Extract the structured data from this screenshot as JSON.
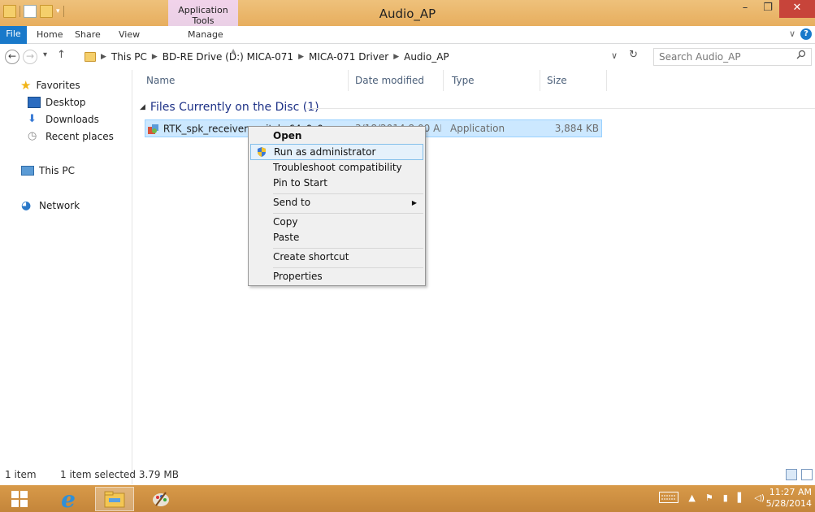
{
  "window": {
    "title": "Audio_AP",
    "contextual_tab_title": "Application Tools",
    "minimize": "–",
    "maximize": "❐",
    "close": "✕"
  },
  "ribbon": {
    "tabs": [
      "File",
      "Home",
      "Share",
      "View",
      "Manage"
    ],
    "expand": "∨",
    "help": "?"
  },
  "address": {
    "back": "←",
    "forward": "→",
    "recent": "▾",
    "up": "↑",
    "crumbs": [
      "This PC",
      "BD-RE Drive (D:) MICA-071",
      "MICA-071 Driver",
      "Audio_AP"
    ],
    "dropdown": "∨",
    "refresh": "↻",
    "search_placeholder": "Search Audio_AP"
  },
  "nav": {
    "favorites": "Favorites",
    "desktop": "Desktop",
    "downloads": "Downloads",
    "recent_places": "Recent places",
    "this_pc": "This PC",
    "network": "Network"
  },
  "columns": {
    "name": "Name",
    "date_modified": "Date modified",
    "type": "Type",
    "size": "Size"
  },
  "group": {
    "title": "Files Currently on the Disc (1)"
  },
  "file": {
    "name": "RTK_spk_receiver_switch_64_0_0",
    "date": "3/18/2014 8:00 AM",
    "type": "Application",
    "size": "3,884 KB"
  },
  "context_menu": {
    "open": "Open",
    "run_as_admin": "Run as administrator",
    "troubleshoot": "Troubleshoot compatibility",
    "pin_to_start": "Pin to Start",
    "send_to": "Send to",
    "copy": "Copy",
    "paste": "Paste",
    "create_shortcut": "Create shortcut",
    "properties": "Properties"
  },
  "status": {
    "items": "1 item",
    "selected": "1 item selected  3.79 MB"
  },
  "taskbar": {
    "time": "11:27 AM",
    "date": "5/28/2014"
  },
  "colors": {
    "accent_title": "#e9b66a",
    "taskbar": "#c98a3e",
    "selection": "#cce8ff",
    "file_tab": "#1979ca"
  }
}
